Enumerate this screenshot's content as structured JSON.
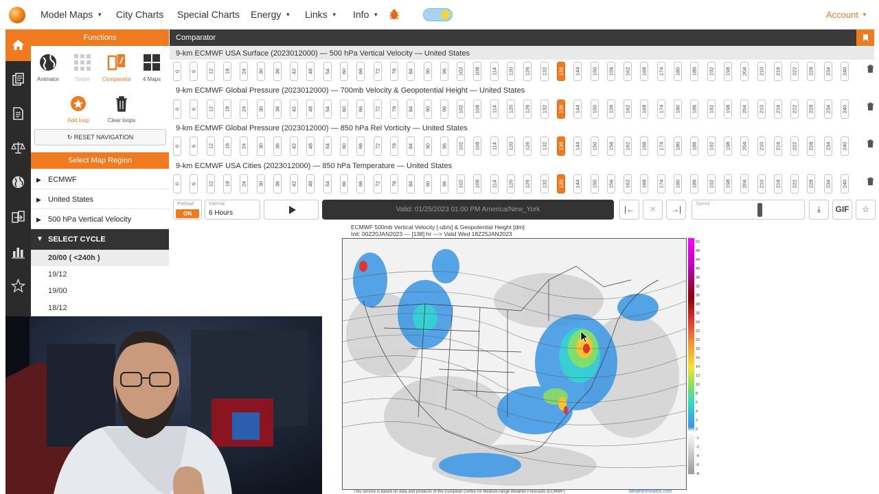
{
  "nav": {
    "items": [
      {
        "label": "Model Maps",
        "caret": true
      },
      {
        "label": "City Charts",
        "caret": false
      },
      {
        "label": "Special Charts",
        "caret": false
      },
      {
        "label": "Energy",
        "caret": true
      },
      {
        "label": "Links",
        "caret": true
      },
      {
        "label": "Info",
        "caret": true
      }
    ],
    "account": "Account"
  },
  "functions": {
    "title": "Functions",
    "tools": [
      {
        "label": "Animator",
        "state": "normal"
      },
      {
        "label": "Swipe",
        "state": "disabled"
      },
      {
        "label": "Comparator",
        "state": "active"
      },
      {
        "label": "4 Maps",
        "state": "normal"
      },
      {
        "label": "Add loop",
        "state": "accent"
      },
      {
        "label": "Clear loops",
        "state": "normal"
      }
    ],
    "reset_label": "RESET NAVIGATION",
    "region_title": "Select Map Region",
    "region_rows": [
      "ECMWF",
      "United States",
      "500 hPa Vertical Velocity"
    ],
    "cycle_title": "SELECT CYCLE",
    "cycles": [
      {
        "label": "20/00 ( <240h )",
        "selected": true
      },
      {
        "label": "19/12",
        "selected": false
      },
      {
        "label": "19/00",
        "selected": false
      },
      {
        "label": "18/12",
        "selected": false
      }
    ]
  },
  "comparator": {
    "title": "Comparator",
    "hours": [
      "0",
      "6",
      "12",
      "18",
      "24",
      "30",
      "36",
      "42",
      "48",
      "54",
      "60",
      "66",
      "72",
      "78",
      "84",
      "90",
      "96",
      "102",
      "108",
      "114",
      "120",
      "126",
      "132",
      "138",
      "144",
      "150",
      "156",
      "162",
      "168",
      "174",
      "180",
      "186",
      "192",
      "198",
      "204",
      "210",
      "216",
      "222",
      "228",
      "234",
      "240"
    ],
    "selected_hour": "138",
    "models": [
      "9-km ECMWF USA Surface (2023012000) — 500 hPa Vertical Velocity — United States",
      "9-km ECMWF Global Pressure (2023012000) — 700mb Velocity & Geopotential Height — United States",
      "9-km ECMWF Global Pressure (2023012000) — 850 hPa Rel Vorticity — United States",
      "9-km ECMWF USA Cities (2023012000) — 850 hPa Temperature — United States"
    ]
  },
  "controls": {
    "preload_label": "Preload",
    "preload_state": "ON",
    "interval_label": "Interval",
    "interval_value": "6 Hours",
    "time_text": "Valid: 01/25/2023 01:00 PM America/New_York",
    "speed_label": "Speed",
    "speed_level": 0.6,
    "gif_label": "GIF"
  },
  "map": {
    "title_line1": "ECMWF 500mb Vertical Velocity [-ub/s] & Geopotential Height [dm]",
    "title_line2": "Init: 00Z20JAN2023 --- [138] hr ---> Valid Wed 18Z25JAN2023",
    "colorbar_ticks": [
      "52",
      "48",
      "44",
      "40",
      "36",
      "32",
      "30",
      "28",
      "26",
      "24",
      "22",
      "20",
      "18",
      "16",
      "14",
      "12",
      "10",
      "8",
      "6",
      "4",
      "2",
      "0",
      "-1",
      "-2",
      "-4",
      "-6",
      "-8"
    ],
    "footer_note": "This service is based on data and products of the European Centre for Medium-range Weather Forecasts (ECMWF)",
    "footer_link": "weathermodels.com"
  },
  "colors": {
    "accent": "#f07a1f",
    "dark": "#333333"
  }
}
